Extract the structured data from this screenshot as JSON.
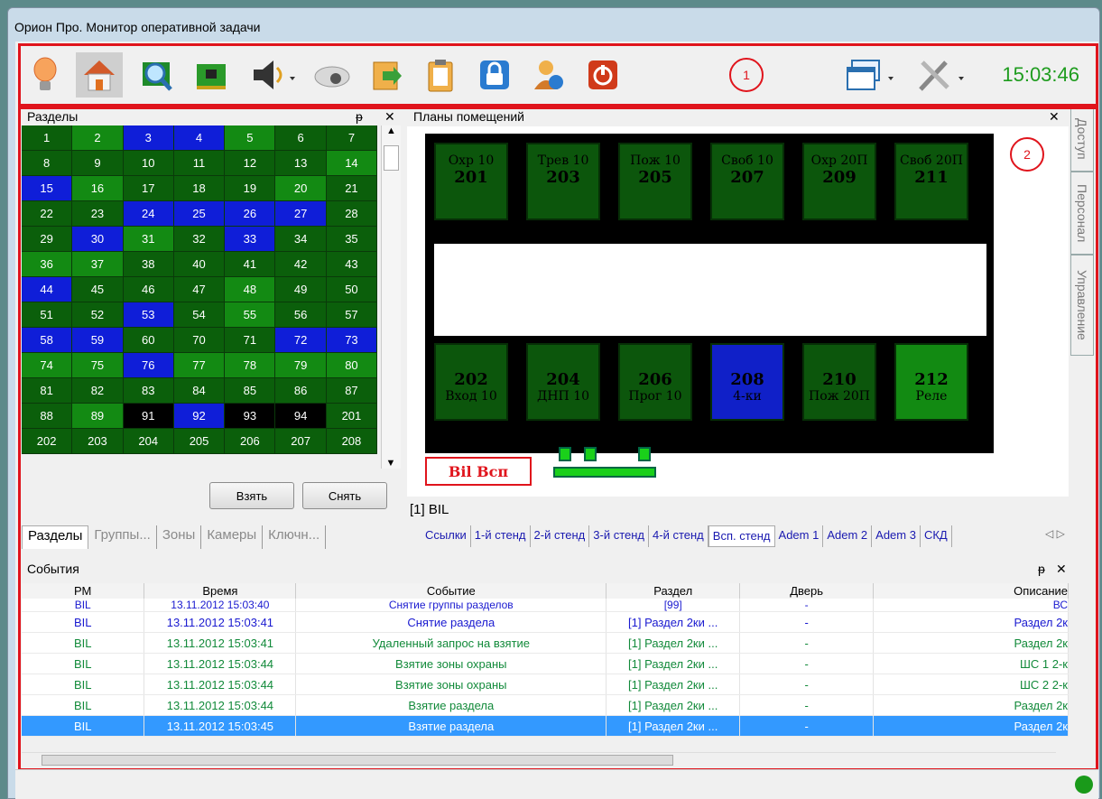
{
  "window": {
    "title": "Орион Про. Монитор оперативной задачи"
  },
  "toolbar": {
    "clock": "15:03:46",
    "marker": "1",
    "buttons": [
      "lamp-icon",
      "home-icon",
      "search-icon",
      "board-icon",
      "speaker-icon",
      "camera-icon",
      "export-icon",
      "clipboard-icon",
      "lock-icon",
      "users-icon",
      "power-icon"
    ]
  },
  "sections": {
    "title": "Разделы",
    "pin": "ᵽ",
    "close": "✕",
    "cells": [
      [
        "1",
        "d"
      ],
      [
        "2",
        "l"
      ],
      [
        "3",
        "b"
      ],
      [
        "4",
        "b"
      ],
      [
        "5",
        "l"
      ],
      [
        "6",
        "d"
      ],
      [
        "7",
        "d"
      ],
      [
        "8",
        "d"
      ],
      [
        "9",
        "d"
      ],
      [
        "10",
        "d"
      ],
      [
        "11",
        "d"
      ],
      [
        "12",
        "d"
      ],
      [
        "13",
        "d"
      ],
      [
        "14",
        "l"
      ],
      [
        "15",
        "b"
      ],
      [
        "16",
        "l"
      ],
      [
        "17",
        "d"
      ],
      [
        "18",
        "d"
      ],
      [
        "19",
        "d"
      ],
      [
        "20",
        "l"
      ],
      [
        "21",
        "d"
      ],
      [
        "22",
        "d"
      ],
      [
        "23",
        "d"
      ],
      [
        "24",
        "b"
      ],
      [
        "25",
        "b"
      ],
      [
        "26",
        "b"
      ],
      [
        "27",
        "b"
      ],
      [
        "28",
        "d"
      ],
      [
        "29",
        "d"
      ],
      [
        "30",
        "b"
      ],
      [
        "31",
        "l"
      ],
      [
        "32",
        "d"
      ],
      [
        "33",
        "b"
      ],
      [
        "34",
        "d"
      ],
      [
        "35",
        "d"
      ],
      [
        "36",
        "l"
      ],
      [
        "37",
        "l"
      ],
      [
        "38",
        "d"
      ],
      [
        "40",
        "d"
      ],
      [
        "41",
        "d"
      ],
      [
        "42",
        "d"
      ],
      [
        "43",
        "d"
      ],
      [
        "44",
        "b"
      ],
      [
        "45",
        "d"
      ],
      [
        "46",
        "d"
      ],
      [
        "47",
        "d"
      ],
      [
        "48",
        "l"
      ],
      [
        "49",
        "d"
      ],
      [
        "50",
        "d"
      ],
      [
        "51",
        "d"
      ],
      [
        "52",
        "d"
      ],
      [
        "53",
        "b"
      ],
      [
        "54",
        "d"
      ],
      [
        "55",
        "l"
      ],
      [
        "56",
        "d"
      ],
      [
        "57",
        "d"
      ],
      [
        "58",
        "b"
      ],
      [
        "59",
        "b"
      ],
      [
        "60",
        "d"
      ],
      [
        "70",
        "d"
      ],
      [
        "71",
        "d"
      ],
      [
        "72",
        "b"
      ],
      [
        "73",
        "b"
      ],
      [
        "74",
        "l"
      ],
      [
        "75",
        "l"
      ],
      [
        "76",
        "b"
      ],
      [
        "77",
        "l"
      ],
      [
        "78",
        "l"
      ],
      [
        "79",
        "l"
      ],
      [
        "80",
        "l"
      ],
      [
        "81",
        "d"
      ],
      [
        "82",
        "d"
      ],
      [
        "83",
        "d"
      ],
      [
        "84",
        "d"
      ],
      [
        "85",
        "d"
      ],
      [
        "86",
        "d"
      ],
      [
        "87",
        "d"
      ],
      [
        "88",
        "d"
      ],
      [
        "89",
        "l"
      ],
      [
        "91",
        "k"
      ],
      [
        "92",
        "b"
      ],
      [
        "93",
        "k"
      ],
      [
        "94",
        "k"
      ],
      [
        "201",
        "d"
      ],
      [
        "202",
        "d"
      ],
      [
        "203",
        "d"
      ],
      [
        "204",
        "d"
      ],
      [
        "205",
        "d"
      ],
      [
        "206",
        "d"
      ],
      [
        "207",
        "d"
      ],
      [
        "208",
        "d"
      ]
    ],
    "take": "Взять",
    "release": "Снять",
    "tabs": [
      "Разделы",
      "Группы...",
      "Зоны",
      "Камеры",
      "Ключн..."
    ]
  },
  "plans": {
    "title": "Планы помещений",
    "close": "✕",
    "marker": "2",
    "footer": "[1] BIL",
    "label": "Bil Всп",
    "top_rooms": [
      [
        "Охр 10",
        "201"
      ],
      [
        "Трев 10",
        "203"
      ],
      [
        "Пож 10",
        "205"
      ],
      [
        "Своб 10",
        "207"
      ],
      [
        "Охр 20П",
        "209"
      ],
      [
        "Своб 20П",
        "211"
      ]
    ],
    "bottom_rooms": [
      [
        "202",
        "Вход 10",
        "d"
      ],
      [
        "204",
        "ДНП 10",
        "d"
      ],
      [
        "206",
        "Прог 10",
        "d"
      ],
      [
        "208",
        "4-ки",
        "b"
      ],
      [
        "210",
        "Пож 20П",
        "d"
      ],
      [
        "212",
        "Реле",
        "l"
      ]
    ],
    "tabs": [
      "Ссылки",
      "1-й стенд",
      "2-й стенд",
      "3-й стенд",
      "4-й стенд",
      "Всп. стенд",
      "Adem 1",
      "Adem 2",
      "Adem 3",
      "СКД"
    ]
  },
  "side_tabs": [
    "Доступ",
    "Персонал",
    "Управление"
  ],
  "events": {
    "title": "События",
    "pin": "ᵽ",
    "close": "✕",
    "columns": [
      "РМ",
      "Время",
      "Событие",
      "Раздел",
      "Дверь",
      "Описание"
    ],
    "rows": [
      [
        "BIL",
        "13.11.2012 15:03:40",
        "Снятие группы разделов",
        "[99]",
        "-",
        "ВС"
      ],
      [
        "BIL",
        "13.11.2012 15:03:41",
        "Снятие раздела",
        "[1] Раздел 2ки ...",
        "-",
        "Раздел 2к"
      ],
      [
        "BIL",
        "13.11.2012 15:03:41",
        "Удаленный запрос на взятие",
        "[1] Раздел 2ки ...",
        "-",
        "Раздел 2к"
      ],
      [
        "BIL",
        "13.11.2012 15:03:44",
        "Взятие зоны охраны",
        "[1] Раздел 2ки ...",
        "-",
        "ШС 1 2-к"
      ],
      [
        "BIL",
        "13.11.2012 15:03:44",
        "Взятие зоны охраны",
        "[1] Раздел 2ки ...",
        "-",
        "ШС 2 2-к"
      ],
      [
        "BIL",
        "13.11.2012 15:03:44",
        "Взятие раздела",
        "[1] Раздел 2ки ...",
        "-",
        "Раздел 2к"
      ],
      [
        "BIL",
        "13.11.2012 15:03:45",
        "Взятие раздела",
        "[1] Раздел 2ки ...",
        "-",
        "Раздел 2к"
      ]
    ],
    "row_colors": [
      "#1a1ad0",
      "#1a1ad0",
      "#128a3a",
      "#128a3a",
      "#128a3a",
      "#128a3a",
      "#ffffff"
    ]
  },
  "colors": {
    "selected_row": "#3399ff",
    "accent_red": "#e0141c",
    "clock_green": "#1e9c1e"
  }
}
